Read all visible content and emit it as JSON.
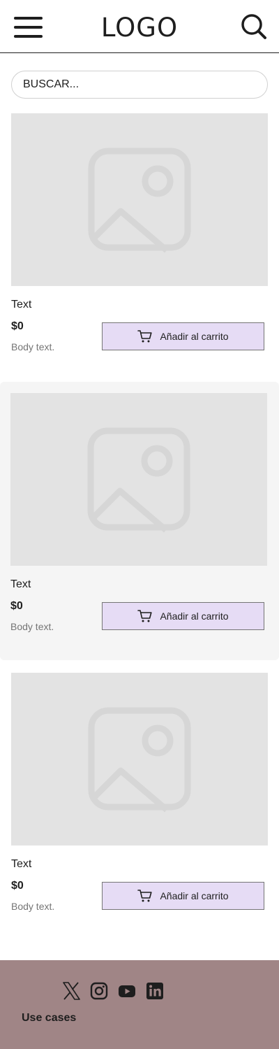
{
  "header": {
    "logo": "LOGO",
    "menu_icon": "hamburger-menu-icon",
    "search_icon": "search-icon"
  },
  "search": {
    "placeholder": "BUSCAR..."
  },
  "products": [
    {
      "title": "Text",
      "price": "$0",
      "body": "Body text.",
      "cart_label": "Añadir al carrito",
      "image_icon": "image-placeholder-icon"
    },
    {
      "title": "Text",
      "price": "$0",
      "body": "Body text.",
      "cart_label": "Añadir al carrito",
      "image_icon": "image-placeholder-icon"
    },
    {
      "title": "Text",
      "price": "$0",
      "body": "Body text.",
      "cart_label": "Añadir al carrito",
      "image_icon": "image-placeholder-icon"
    }
  ],
  "footer": {
    "social_icons": [
      "x-icon",
      "instagram-icon",
      "youtube-icon",
      "linkedin-icon"
    ],
    "link": "Use cases"
  },
  "colors": {
    "cart_button_bg": "#e6dcf5",
    "footer_bg": "#a08586",
    "image_placeholder": "#e3e3e3",
    "highlight_card_bg": "#f5f5f5"
  }
}
